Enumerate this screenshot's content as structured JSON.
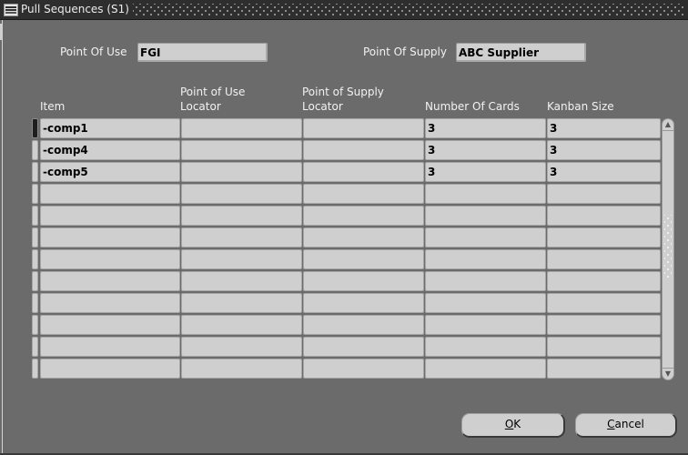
{
  "window": {
    "title": "Pull Sequences (S1)",
    "icon": "oracle-forms-icon"
  },
  "header_fields": {
    "point_of_use": {
      "label": "Point Of Use",
      "value": "FGI"
    },
    "point_of_supply": {
      "label": "Point Of Supply",
      "value": "ABC Supplier"
    }
  },
  "table": {
    "columns": [
      {
        "key": "item",
        "label": "Item"
      },
      {
        "key": "pou_locator",
        "label": "Point of Use\nLocator"
      },
      {
        "key": "pos_locator",
        "label": "Point of Supply\nLocator"
      },
      {
        "key": "num_cards",
        "label": "Number Of Cards"
      },
      {
        "key": "kanban_size",
        "label": "Kanban Size"
      }
    ],
    "rows": [
      {
        "item": "-comp1",
        "pou_locator": "",
        "pos_locator": "",
        "num_cards": "3",
        "kanban_size": "3",
        "active": true
      },
      {
        "item": "-comp4",
        "pou_locator": "",
        "pos_locator": "",
        "num_cards": "3",
        "kanban_size": "3"
      },
      {
        "item": "-comp5",
        "pou_locator": "",
        "pos_locator": "",
        "num_cards": "3",
        "kanban_size": "3"
      },
      {
        "item": "",
        "pou_locator": "",
        "pos_locator": "",
        "num_cards": "",
        "kanban_size": ""
      },
      {
        "item": "",
        "pou_locator": "",
        "pos_locator": "",
        "num_cards": "",
        "kanban_size": ""
      },
      {
        "item": "",
        "pou_locator": "",
        "pos_locator": "",
        "num_cards": "",
        "kanban_size": ""
      },
      {
        "item": "",
        "pou_locator": "",
        "pos_locator": "",
        "num_cards": "",
        "kanban_size": ""
      },
      {
        "item": "",
        "pou_locator": "",
        "pos_locator": "",
        "num_cards": "",
        "kanban_size": ""
      },
      {
        "item": "",
        "pou_locator": "",
        "pos_locator": "",
        "num_cards": "",
        "kanban_size": ""
      },
      {
        "item": "",
        "pou_locator": "",
        "pos_locator": "",
        "num_cards": "",
        "kanban_size": ""
      },
      {
        "item": "",
        "pou_locator": "",
        "pos_locator": "",
        "num_cards": "",
        "kanban_size": ""
      },
      {
        "item": "",
        "pou_locator": "",
        "pos_locator": "",
        "num_cards": "",
        "kanban_size": ""
      }
    ],
    "scrollbar": {
      "up_glyph": "▲",
      "down_glyph": "▼"
    }
  },
  "buttons": {
    "ok": {
      "mnemonic": "O",
      "rest": "K"
    },
    "cancel": {
      "mnemonic": "C",
      "rest": "ancel"
    }
  }
}
